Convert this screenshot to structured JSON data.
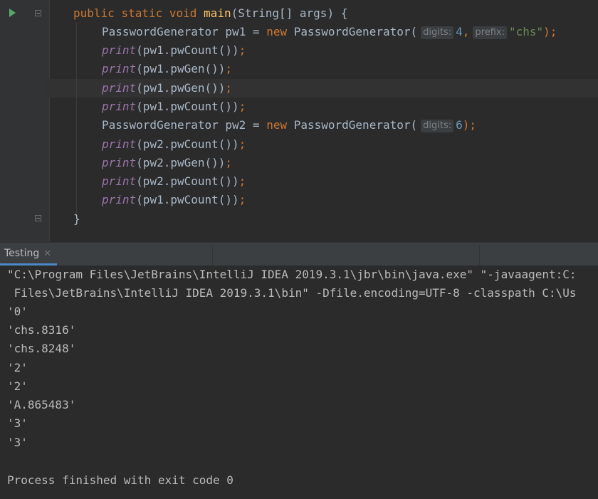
{
  "editor": {
    "code": {
      "main_signature": {
        "kw1": "public",
        "kw2": "static",
        "kw3": "void",
        "name": "main",
        "params": "(String[] args) {"
      },
      "line_pw1": {
        "decl": "PasswordGenerator pw1 = ",
        "new": "new",
        "ctor": " PasswordGenerator(",
        "hint_digits": "digits:",
        "digits": "4",
        "comma": ",",
        "hint_prefix": "prefix:",
        "prefix": "\"chs\"",
        "close": ");"
      },
      "calls": [
        {
          "fn": "print",
          "args": "(pw1.pwCount())",
          "semi": ";"
        },
        {
          "fn": "print",
          "args": "(pw1.pwGen())",
          "semi": ";"
        },
        {
          "fn": "print",
          "args": "(pw1.pwGen())",
          "semi": ";"
        },
        {
          "fn": "print",
          "args": "(pw1.pwCount())",
          "semi": ";"
        }
      ],
      "line_pw2": {
        "decl": "PasswordGenerator pw2 = ",
        "new": "new",
        "ctor": " PasswordGenerator(",
        "hint_digits": "digits:",
        "digits": "6",
        "close": ");"
      },
      "calls2": [
        {
          "fn": "print",
          "args": "(pw2.pwCount())",
          "semi": ";"
        },
        {
          "fn": "print",
          "args": "(pw2.pwGen())",
          "semi": ";"
        },
        {
          "fn": "print",
          "args": "(pw2.pwCount())",
          "semi": ";"
        },
        {
          "fn": "print",
          "args": "(pw1.pwCount())",
          "semi": ";"
        }
      ],
      "closing_brace": "}"
    }
  },
  "tool_window": {
    "tab_label": "Testing",
    "tab_close": "✕"
  },
  "console": {
    "lines": [
      "\"C:\\Program Files\\JetBrains\\IntelliJ IDEA 2019.3.1\\jbr\\bin\\java.exe\" \"-javaagent:C:",
      " Files\\JetBrains\\IntelliJ IDEA 2019.3.1\\bin\" -Dfile.encoding=UTF-8 -classpath C:\\Us",
      "'0'",
      "'chs.8316'",
      "'chs.8248'",
      "'2'",
      "'2'",
      "'A.865483'",
      "'3'",
      "'3'",
      "",
      "Process finished with exit code 0"
    ]
  }
}
